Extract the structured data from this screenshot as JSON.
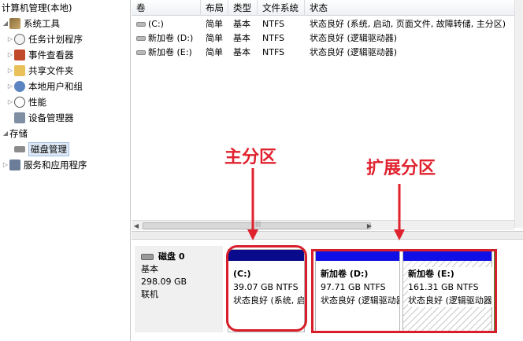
{
  "tree": {
    "root": "计算机管理(本地)",
    "items": [
      {
        "label": "系统工具",
        "arrow": "◢",
        "level": 0
      },
      {
        "label": "任务计划程序",
        "arrow": "▷",
        "level": 1
      },
      {
        "label": "事件查看器",
        "arrow": "▷",
        "level": 1
      },
      {
        "label": "共享文件夹",
        "arrow": "▷",
        "level": 1
      },
      {
        "label": "本地用户和组",
        "arrow": "▷",
        "level": 1
      },
      {
        "label": "性能",
        "arrow": "▷",
        "level": 1
      },
      {
        "label": "设备管理器",
        "arrow": "",
        "level": 1
      },
      {
        "label": "存储",
        "arrow": "◢",
        "level": 0
      },
      {
        "label": "磁盘管理",
        "arrow": "",
        "level": 1
      },
      {
        "label": "服务和应用程序",
        "arrow": "▷",
        "level": 0
      }
    ]
  },
  "table": {
    "columns": [
      "卷",
      "布局",
      "类型",
      "文件系统",
      "状态"
    ],
    "rows": [
      [
        "(C:)",
        "简单",
        "基本",
        "NTFS",
        "状态良好 (系统, 启动, 页面文件, 故障转储, 主分区)"
      ],
      [
        "新加卷 (D:)",
        "简单",
        "基本",
        "NTFS",
        "状态良好 (逻辑驱动器)"
      ],
      [
        "新加卷 (E:)",
        "简单",
        "基本",
        "NTFS",
        "状态良好 (逻辑驱动器)"
      ]
    ]
  },
  "disk": {
    "name": "磁盘 0",
    "type": "基本",
    "size": "298.09 GB",
    "status": "联机"
  },
  "partitions": [
    {
      "name": "(C:)",
      "size": "39.07 GB NTFS",
      "status": "状态良好 (系统, 启动, 页面文件, 故障转储, 主分区)"
    },
    {
      "name": "新加卷  (D:)",
      "size": "97.71 GB NTFS",
      "status": "状态良好 (逻辑驱动器)"
    },
    {
      "name": "新加卷  (E:)",
      "size": "161.31 GB NTFS",
      "status": "状态良好 (逻辑驱动器)"
    }
  ],
  "annotations": {
    "primary": "主分区",
    "extended": "扩展分区"
  },
  "colors": {
    "primary_bar": "#0a0a8c",
    "logical_bar": "#1010e6",
    "annotation": "#e0222e"
  }
}
